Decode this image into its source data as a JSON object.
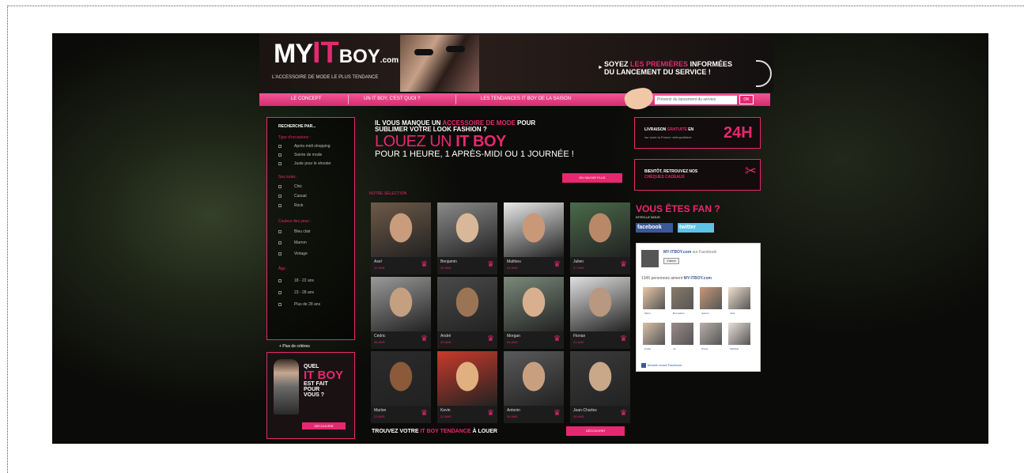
{
  "header": {
    "logo_my": "MY",
    "logo_it": "IT",
    "logo_boy": "BOY",
    "logo_com": ".com",
    "tagline": "L'ACCESSOIRE DE MODE LE PLUS TENDANCE",
    "promo_line1_a": "SOYEZ ",
    "promo_line1_b": "LES PREMIÈRES",
    "promo_line1_c": " INFORMÉES",
    "promo_line2": "DU LANCEMENT DU SERVICE !"
  },
  "nav": {
    "items": [
      {
        "label": "LE CONCEPT"
      },
      {
        "label": "UN IT BOY, C'EST QUOI ?"
      },
      {
        "label": "LES TENDANCES IT BOY DE LA SAISON"
      }
    ],
    "notify_placeholder": "Prévenir du lancement du service",
    "notify_button": "OK"
  },
  "sidebar": {
    "title": "RECHERCHE PAR...",
    "groups": [
      {
        "label": "Type d'occasions :",
        "options": [
          "Après-midi shopping",
          "Soirée de mode",
          "Juste pour le shooter"
        ]
      },
      {
        "label": "Ses looks :",
        "options": [
          "Chic",
          "Casual",
          "Rock"
        ]
      },
      {
        "label": "Couleur des yeux :",
        "options": [
          "Bleu clair",
          "Marron",
          "Vintage"
        ]
      },
      {
        "label": "Âge :",
        "options": [
          "18 - 22 ans",
          "23 - 28 ans",
          "Plus de 28 ans"
        ]
      }
    ],
    "more_criteria": "+ Plus de critères",
    "quel_line1": "QUEL",
    "quel_line2": "IT BOY",
    "quel_line3": "EST FAIT",
    "quel_line4": "POUR",
    "quel_line5": "VOUS ?",
    "quel_button": "DÉCOUVRIR"
  },
  "main": {
    "intro_line1_a": "IL VOUS MANQUE UN ",
    "intro_line1_b": "ACCESSOIRE DE MODE",
    "intro_line1_c": " POUR",
    "intro_line2": "SUBLIMER VOTRE LOOK FASHION ?",
    "intro_big_a": "LOUEZ UN ",
    "intro_big_b": "IT BOY",
    "intro_sub": "POUR 1 HEURE, 1 APRÈS-MIDI OU 1 JOURNÉE !",
    "how_button": "EN SAVOIR PLUS",
    "selection_title": "NOTRE SÉLECTION",
    "find_a": "TROUVEZ VOTRE ",
    "find_b": "IT BOY TENDANCE",
    "find_c": " À LOUER",
    "find_button": "DÉCOUVRIR",
    "boys": [
      {
        "name": "Axel",
        "age": "22 ANS"
      },
      {
        "name": "Benjamin",
        "age": "25 ANS"
      },
      {
        "name": "Mathieu",
        "age": "24 ANS"
      },
      {
        "name": "Julien",
        "age": "27 ANS"
      },
      {
        "name": "Cédric",
        "age": "26 ANS"
      },
      {
        "name": "André",
        "age": "29 ANS"
      },
      {
        "name": "Morgan",
        "age": "25 ANS"
      },
      {
        "name": "Florian",
        "age": "21 ANS"
      },
      {
        "name": "Marlon",
        "age": "23 ANS"
      },
      {
        "name": "Kevin",
        "age": "22 ANS"
      },
      {
        "name": "Antonin",
        "age": "26 ANS"
      },
      {
        "name": "Jean-Charles",
        "age": "28 ANS"
      }
    ]
  },
  "right": {
    "delivery_a": "LIVRAISON ",
    "delivery_b": "GRATUITE",
    "delivery_c": " EN",
    "delivery_sub": "sur toute la France métropolitaine",
    "delivery_big": "24H",
    "cheques_line1": "BIENTÔT, RETROUVEZ NOS",
    "cheques_line2": "CHÈQUES CADEAUX",
    "fan_title": "VOUS ÊTES FAN ?",
    "fan_sub": "DITES-LE NOUS",
    "facebook": "facebook",
    "twitter": "twitter",
    "fb_page": "MY-ITBOY.com",
    "fb_on": " sur Facebook",
    "fb_like": "J'aime",
    "fb_count_a": "1345",
    "fb_count_b": " personnes aiment ",
    "fb_count_c": "MY-ITBOY.com",
    "fb_fans": [
      "Marie",
      "Bernadette",
      "Justine",
      "Julie",
      "Emilie",
      "Lili",
      "Nicole",
      "Mathilde"
    ],
    "fb_plugin": "Module social Facebook"
  }
}
